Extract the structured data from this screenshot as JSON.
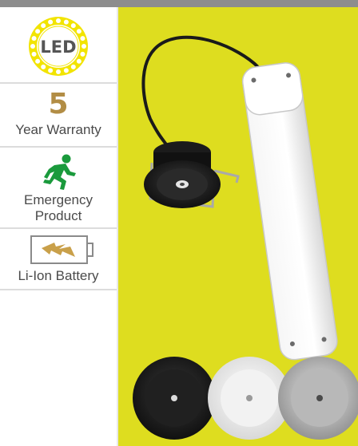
{
  "features": {
    "led": {
      "badge_text": "LED",
      "icon": "led-badge-icon"
    },
    "warranty": {
      "years": "5",
      "label": "Year Warranty"
    },
    "emergency": {
      "label": "Emergency\nProduct",
      "icon": "running-man-icon"
    },
    "battery": {
      "label": "Li-Ion Battery",
      "icon": "battery-icon"
    }
  },
  "colors": {
    "background": "#dedd1f",
    "accent_gold": "#b28d45",
    "led_yellow": "#f2e400",
    "emergency_green": "#1a9a3c",
    "topbar": "#8d8d8d"
  },
  "product_finishes": [
    "black",
    "white",
    "silver"
  ]
}
